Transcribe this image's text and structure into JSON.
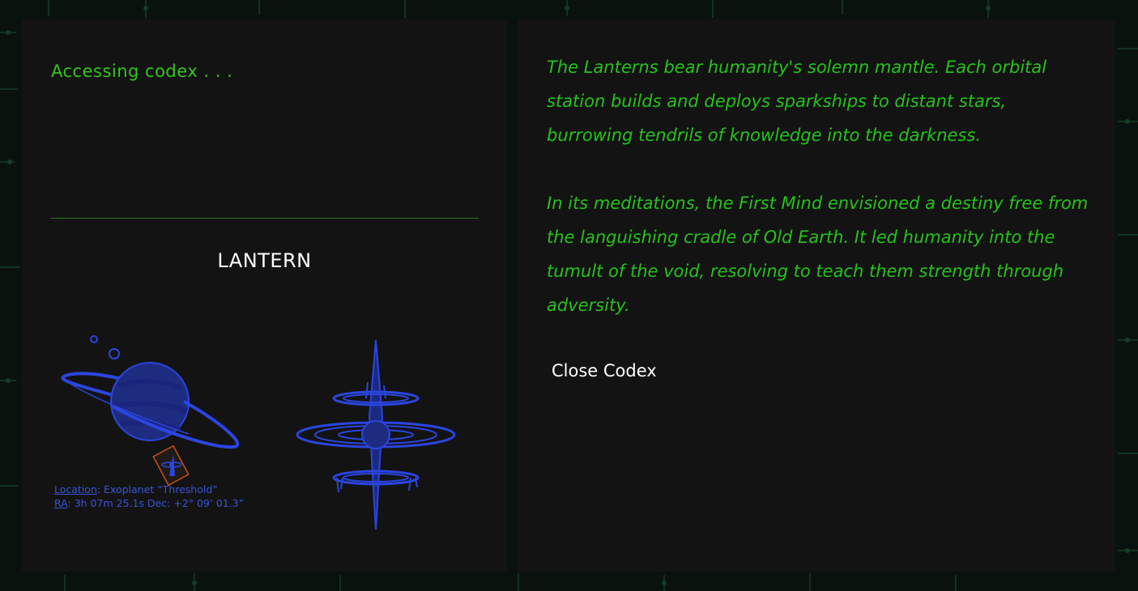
{
  "codex": {
    "status": "Accessing codex . . .",
    "title": "LANTERN",
    "location_label": "Location",
    "location_value": ": Exoplanet “Threshold”",
    "ra_label": "RA",
    "ra_value": ": 3h 07m 25.1s Dec: +2° 09’ 01.3”",
    "lore_p1": "The Lanterns bear humanity's solemn mantle. Each orbital station builds and deploys sparkships to distant stars, burrowing tendrils of knowledge into the darkness.",
    "lore_p2": "In its meditations, the First Mind envisioned a destiny free from the languishing cradle of Old Earth. It led humanity into the tumult of the void, resolving to teach them strength through adversity.",
    "close_label": "Close Codex"
  },
  "colors": {
    "accent_green": "#2cc41c",
    "illustration_blue": "#2b45e0",
    "marker_orange": "#c8501c",
    "panel_bg": "#131313"
  },
  "icons": [
    "ringed-planet-icon",
    "lantern-station-icon",
    "location-marker-icon"
  ]
}
